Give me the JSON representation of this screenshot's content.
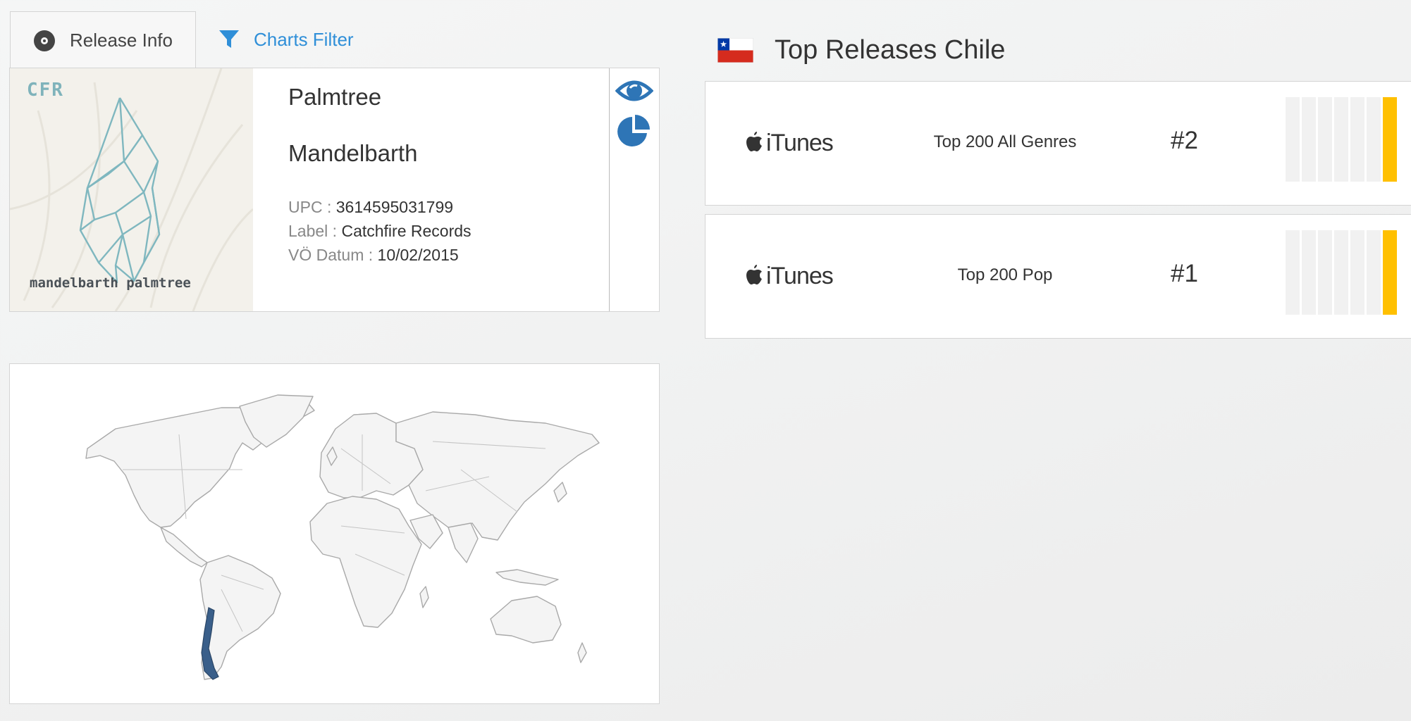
{
  "tabs": [
    {
      "label": "Release Info",
      "icon": "disc-icon",
      "active": true
    },
    {
      "label": "Charts Filter",
      "icon": "filter-icon",
      "active": false
    }
  ],
  "release": {
    "cover_brand": "CFR",
    "cover_caption": "mandelbarth palmtree",
    "title": "Palmtree",
    "artist": "Mandelbarth",
    "upc_label": "UPC : ",
    "upc": "3614595031799",
    "label_label": "Label : ",
    "label": "Catchfire Records",
    "date_label": "VÖ Datum : ",
    "date": "10/02/2015"
  },
  "side_icons": [
    "eye-icon",
    "pie-chart-icon"
  ],
  "map": {
    "highlighted_country": "Chile",
    "highlight_color": "#3a5f8a"
  },
  "charts_panel": {
    "title": "Top Releases Chile",
    "flag": "chile-flag-icon",
    "rows": [
      {
        "store": "iTunes",
        "chart": "Top 200 All Genres",
        "rank": "#2",
        "level": 1
      },
      {
        "store": "iTunes",
        "chart": "Top 200 Pop",
        "rank": "#1",
        "level": 1
      }
    ]
  },
  "colors": {
    "accent_blue": "#2f8fd8",
    "icon_blue": "#2e75b6",
    "bar_active": "#ffc000",
    "bar_inactive": "#f1f1f1"
  }
}
